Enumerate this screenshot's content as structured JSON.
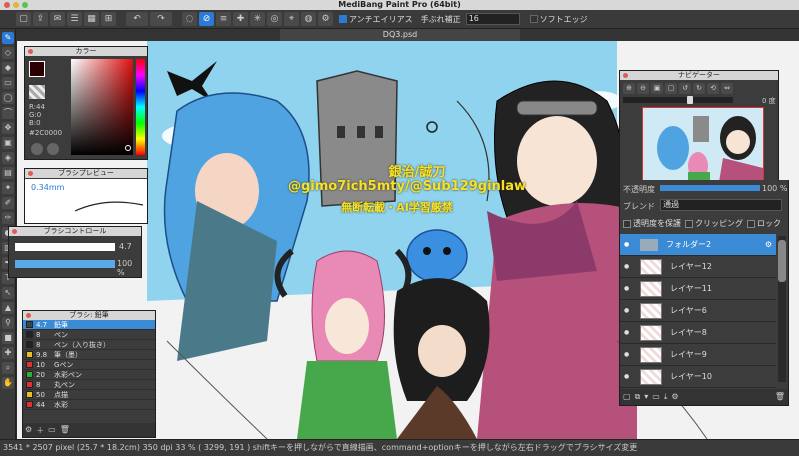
{
  "window": {
    "title": "MediBang Paint Pro (64bit)"
  },
  "toolbar": {
    "antialias_label": "アンチエイリアス",
    "stabilizer_label": "手ぶれ補正",
    "stabilizer_value": "16",
    "soft_edge_label": "ソフトエッジ"
  },
  "document": {
    "tab_title": "DQ3.psd"
  },
  "canvas_overlay": {
    "line1": "銀治/誠刀",
    "line2": "@gimo7ich5mty/@Sub129ginlaw",
    "line3": "無断転載・AI学習厳禁"
  },
  "color_panel": {
    "title": "カラー",
    "r": "R:44",
    "g": "G:0",
    "b": "B:0",
    "hex": "#2C0000",
    "foreground": "#2c0000"
  },
  "brush_preview": {
    "title": "ブラシプレビュー",
    "size": "0.34mm"
  },
  "brush_control": {
    "title": "ブラシコントロール",
    "size_value": "4.7",
    "opacity_value": "100 %"
  },
  "brush_panel": {
    "title": "ブラシ: 鉛筆",
    "items": [
      {
        "size": "4.7",
        "name": "鉛筆",
        "color": "#444444"
      },
      {
        "size": "8",
        "name": "ペン",
        "color": "#222222"
      },
      {
        "size": "8",
        "name": "ペン（入り抜き）",
        "color": "#222222"
      },
      {
        "size": "9.8",
        "name": "筆（墨）",
        "color": "#e8c020"
      },
      {
        "size": "10",
        "name": "Gペン",
        "color": "#e03030"
      },
      {
        "size": "20",
        "name": "水彩ペン",
        "color": "#30b030"
      },
      {
        "size": "8",
        "name": "丸ペン",
        "color": "#e03030"
      },
      {
        "size": "50",
        "name": "点描",
        "color": "#e8c020"
      },
      {
        "size": "44",
        "name": "水彩",
        "color": "#e03030"
      }
    ]
  },
  "navigator": {
    "title": "ナビゲーター",
    "zoom": "0 度"
  },
  "layer_panel": {
    "opacity_label": "不透明度",
    "opacity_value": "100 %",
    "blend_label": "ブレンド",
    "blend_value": "通過",
    "protect_label": "透明度を保護",
    "clipping_label": "クリッピング",
    "lock_label": "ロック",
    "layers": [
      {
        "name": "フォルダー2",
        "type": "folder",
        "selected": true
      },
      {
        "name": "レイヤー12",
        "type": "layer",
        "selected": false
      },
      {
        "name": "レイヤー11",
        "type": "layer",
        "selected": false
      },
      {
        "name": "レイヤー6",
        "type": "layer",
        "selected": false
      },
      {
        "name": "レイヤー8",
        "type": "layer",
        "selected": false
      },
      {
        "name": "レイヤー9",
        "type": "layer",
        "selected": false
      },
      {
        "name": "レイヤー10",
        "type": "layer",
        "selected": false
      }
    ]
  },
  "status": {
    "size": "3541 * 2507 pixel",
    "physical": "(25.7 * 18.2cm)",
    "dpi": "350 dpi",
    "zoom": "33 %",
    "coords": "( 3299, 191 )",
    "hint": "shiftキーを押しながらで直線描画、command+optionキーを押しながら左右ドラッグでブラシサイズ変更"
  },
  "colors": {
    "accent": "#2a7ad6",
    "sky": "#8fd3ee",
    "overlay_text": "#f4e22a"
  }
}
